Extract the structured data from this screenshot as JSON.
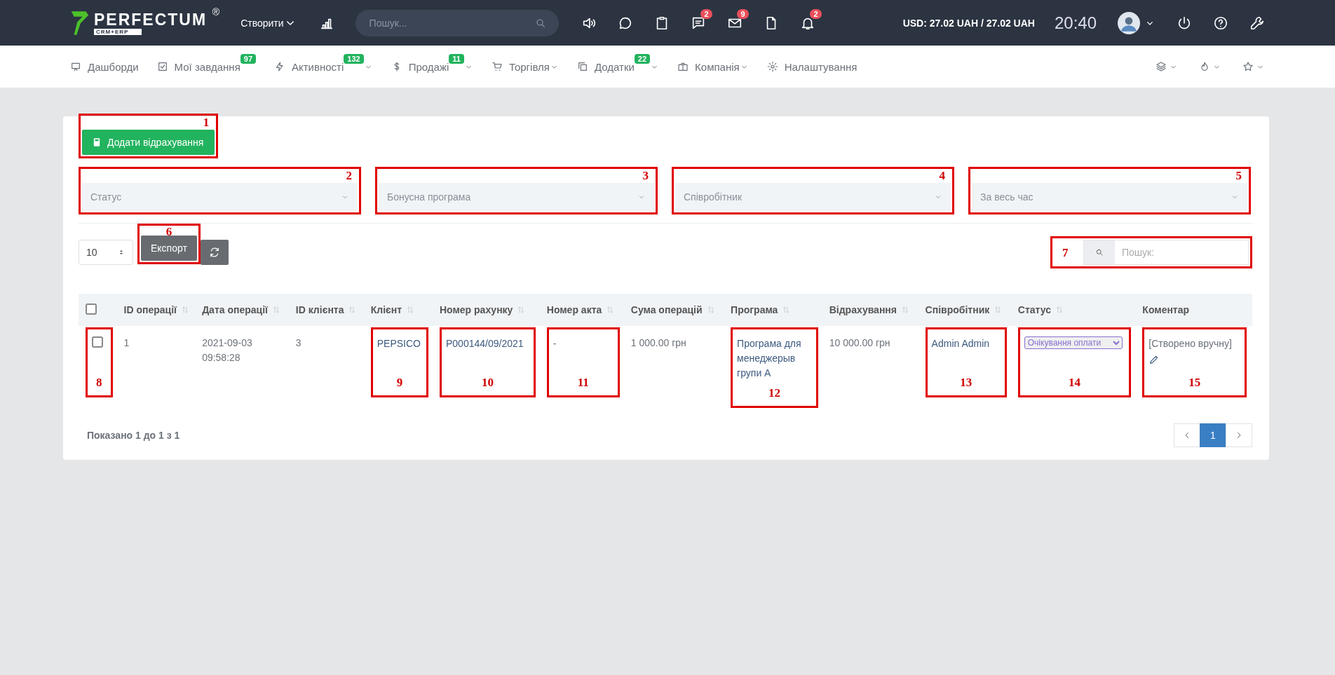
{
  "topbar": {
    "logo": "PERFECTUM",
    "logo_mark": "®",
    "logo_sub": "CRM+ERP",
    "create": "Створити",
    "search": {
      "placeholder": "Пошук..."
    },
    "message_badge": "2",
    "mail_badge": "9",
    "bell_badge": "2",
    "rate": "USD: 27.02 UAH / 27.02 UAH",
    "time": "20:40"
  },
  "nav": [
    {
      "label": "Дашборди",
      "caret": false
    },
    {
      "label": "Мої завдання",
      "badge": "97",
      "caret": false
    },
    {
      "label": "Активності",
      "badge": "132",
      "caret": true
    },
    {
      "label": "Продажі",
      "badge": "11",
      "caret": true
    },
    {
      "label": "Торгівля",
      "caret": true
    },
    {
      "label": "Додатки",
      "badge": "22",
      "caret": true
    },
    {
      "label": "Компанія",
      "caret": true
    },
    {
      "label": "Налаштування",
      "caret": false
    }
  ],
  "add_button": {
    "label": "Додати відрахування",
    "annotation": {
      "number": "1",
      "kind": "corner"
    }
  },
  "filters": [
    {
      "placeholder": "Статус",
      "annotation": {
        "number": "2",
        "kind": "corner"
      }
    },
    {
      "placeholder": "Бонусна програма",
      "annotation": {
        "number": "3",
        "kind": "corner"
      }
    },
    {
      "placeholder": "Співробітник",
      "annotation": {
        "number": "4",
        "kind": "corner"
      }
    },
    {
      "placeholder": "За весь час",
      "annotation": {
        "number": "5",
        "kind": "corner"
      }
    }
  ],
  "page_size": "10",
  "export_button": {
    "label": "Експорт",
    "annotation": {
      "number": "6",
      "kind": "above"
    }
  },
  "table_search": {
    "placeholder": "Пошук:",
    "annotation": {
      "number": "7",
      "kind": "side"
    }
  },
  "table": {
    "columns": [
      {
        "kind": "checkbox",
        "checked": false
      },
      {
        "label": "ID операції",
        "sortable": true
      },
      {
        "label": "Дата операції",
        "sortable": true
      },
      {
        "label": "ID клієнта",
        "sortable": true
      },
      {
        "label": "Клієнт",
        "sortable": true
      },
      {
        "label": "Номер рахунку",
        "sortable": true
      },
      {
        "label": "Номер акта",
        "sortable": true
      },
      {
        "label": "Сума операцій",
        "sortable": true
      },
      {
        "label": "Програма",
        "sortable": true
      },
      {
        "label": "Відрахування",
        "sortable": true
      },
      {
        "label": "Співробітник",
        "sortable": true
      },
      {
        "label": "Статус",
        "sortable": true
      },
      {
        "label": "Коментар",
        "sortable": false
      }
    ],
    "rows": [
      {
        "cells": [
          {
            "kind": "checkbox",
            "checked": false,
            "annotation": {
              "number": "8",
              "kind": "below"
            }
          },
          {
            "kind": "text",
            "text": "1"
          },
          {
            "kind": "text",
            "text": "2021-09-03 09:58:28"
          },
          {
            "kind": "text",
            "text": "3"
          },
          {
            "kind": "link",
            "text": "PEPSICO",
            "annotation": {
              "number": "9",
              "kind": "below"
            }
          },
          {
            "kind": "link",
            "text": "P000144/09/2021",
            "annotation": {
              "number": "10",
              "kind": "below"
            }
          },
          {
            "kind": "text",
            "text": "-",
            "annotation": {
              "number": "11",
              "kind": "below"
            }
          },
          {
            "kind": "text",
            "text": "1 000.00 грн"
          },
          {
            "kind": "link",
            "text": "Програма для менеджерыв групи А",
            "annotation": {
              "number": "12",
              "kind": "below"
            }
          },
          {
            "kind": "text",
            "text": "10 000.00 грн"
          },
          {
            "kind": "link",
            "text": "Admin Admin",
            "annotation": {
              "number": "13",
              "kind": "below"
            }
          },
          {
            "kind": "select",
            "text": "Очікування оплати",
            "annotation": {
              "number": "14",
              "kind": "below"
            }
          },
          {
            "kind": "comment",
            "text": "[Створено вручну]",
            "annotation": {
              "number": "15",
              "kind": "below"
            }
          }
        ]
      }
    ]
  },
  "info": "Показано 1 до 1 з 1",
  "pagination": [
    {
      "label": "1",
      "selected": true
    }
  ]
}
